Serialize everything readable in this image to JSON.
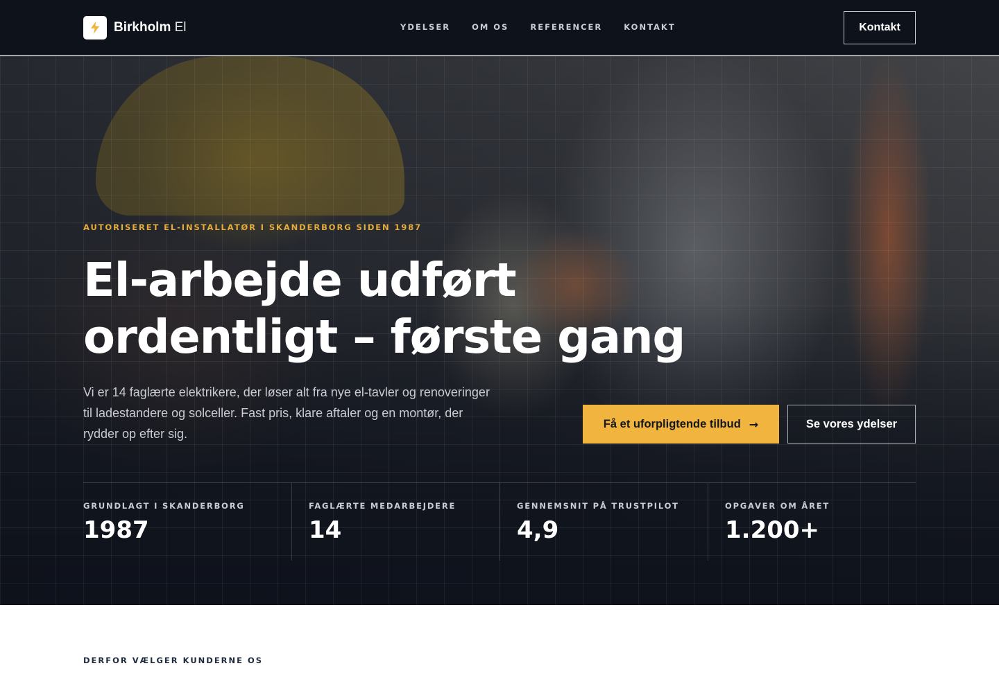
{
  "nav": {
    "logo_bold": "Birkholm",
    "logo_light": " El",
    "links": [
      "YDELSER",
      "OM OS",
      "REFERENCER",
      "KONTAKT"
    ],
    "cta_label": "Kontakt"
  },
  "hero": {
    "eyebrow": "AUTORISERET EL-INSTALLATØR I SKANDERBORG SIDEN 1987",
    "headline_line1": "El-arbejde udført",
    "headline_line2": "ordentligt – første gang",
    "lede": "Vi er 14 faglærte elektrikere, der løser alt fra nye el-tavler og renoveringer til ladestandere og solceller. Fast pris, klare aftaler og en montør, der rydder op efter sig.",
    "primary_cta": "Få et uforpligtende tilbud",
    "primary_cta_arrow": "→",
    "secondary_cta": "Se vores ydelser"
  },
  "stats": [
    {
      "label": "GRUNDLAGT I SKANDERBORG",
      "value": "1987"
    },
    {
      "label": "FAGLÆRTE MEDARBEJDERE",
      "value": "14"
    },
    {
      "label": "GENNEMSNIT PÅ TRUSTPILOT",
      "value": "4,9"
    },
    {
      "label": "OPGAVER OM ÅRET",
      "value": "1.200+"
    }
  ],
  "why": {
    "eyebrow": "DERFOR VÆLGER KUNDERNE OS"
  },
  "colors": {
    "accent": "#f0b43f",
    "nav_bg": "#0e121b"
  },
  "icons": {
    "logo": "lightning-bolt-icon",
    "cta_arrow": "arrow-right-icon"
  }
}
